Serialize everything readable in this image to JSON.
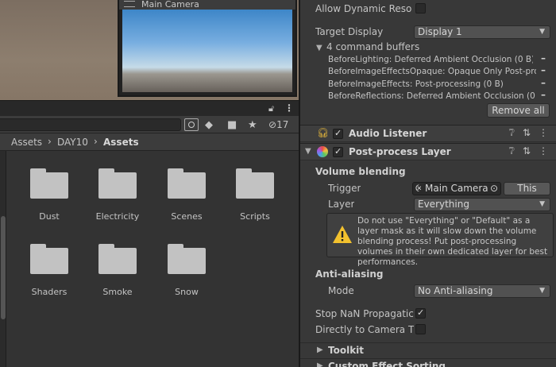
{
  "scene": {
    "camera_preview_title": "Main Camera"
  },
  "project": {
    "hidden_count": "17",
    "breadcrumb": [
      "Assets",
      "DAY10",
      "Assets"
    ],
    "folders": [
      "Dust",
      "Electricity",
      "Scenes",
      "Scripts",
      "Shaders",
      "Smoke",
      "Snow"
    ]
  },
  "inspector": {
    "allow_dynamic_resolution_label": "Allow Dynamic Reso",
    "target_display_label": "Target Display",
    "target_display_value": "Display 1",
    "command_buffers_label": "4 command buffers",
    "command_buffers": [
      "BeforeLighting: Deferred Ambient Occlusion (0 B)",
      "BeforeImageEffectsOpaque: Opaque Only Post-pro",
      "BeforeImageEffects: Post-processing (0 B)",
      "BeforeReflections: Deferred Ambient Occlusion (0 B"
    ],
    "remove_all_label": "Remove all",
    "audio_listener_title": "Audio Listener",
    "post_process_title": "Post-process Layer",
    "volume_blending_label": "Volume blending",
    "trigger_label": "Trigger",
    "trigger_value": "Main Camera",
    "this_button_label": "This",
    "layer_label": "Layer",
    "layer_value": "Everything",
    "warning_text": "Do not use \"Everything\" or \"Default\" as a layer mask as it will slow down the volume blending process! Put post-processing volumes in their own dedicated layer for best performances.",
    "anti_aliasing_label": "Anti-aliasing",
    "mode_label": "Mode",
    "mode_value": "No Anti-aliasing",
    "stop_nan_label": "Stop NaN Propagatic",
    "directly_to_camera_label": "Directly to Camera T",
    "toolkit_label": "Toolkit",
    "custom_effect_sorting_label": "Custom Effect Sorting"
  }
}
